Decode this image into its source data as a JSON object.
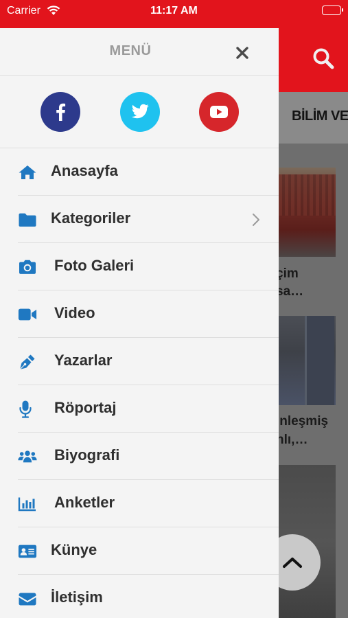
{
  "status_bar": {
    "carrier": "Carrier",
    "time": "11:17 AM"
  },
  "drawer": {
    "title": "MENÜ",
    "social": [
      {
        "name": "facebook-icon",
        "color": "#2d3a8c"
      },
      {
        "name": "twitter-icon",
        "color": "#1fc2ef"
      },
      {
        "name": "youtube-icon",
        "color": "#d6262b"
      }
    ],
    "items": [
      {
        "label": "Anasayfa",
        "icon": "home-icon"
      },
      {
        "label": "Kategoriler",
        "icon": "folder-icon",
        "has_submenu": true
      },
      {
        "label": "Foto Galeri",
        "icon": "camera-icon"
      },
      {
        "label": "Video",
        "icon": "video-icon"
      },
      {
        "label": "Yazarlar",
        "icon": "pen-icon"
      },
      {
        "label": "Röportaj",
        "icon": "microphone-icon"
      },
      {
        "label": "Biyografi",
        "icon": "users-icon"
      },
      {
        "label": "Anketler",
        "icon": "chart-icon"
      },
      {
        "label": "Künye",
        "icon": "id-card-icon"
      },
      {
        "label": "İletişim",
        "icon": "envelope-icon"
      }
    ]
  },
  "background": {
    "tab_label": "BİLİM VE",
    "snippets": [
      "çim",
      "sa…",
      "inleşmiş",
      "nlı,…"
    ]
  },
  "colors": {
    "brand_red": "#e2141c",
    "icon_blue": "#1f78c1",
    "text_dark": "#2f2f2f"
  }
}
